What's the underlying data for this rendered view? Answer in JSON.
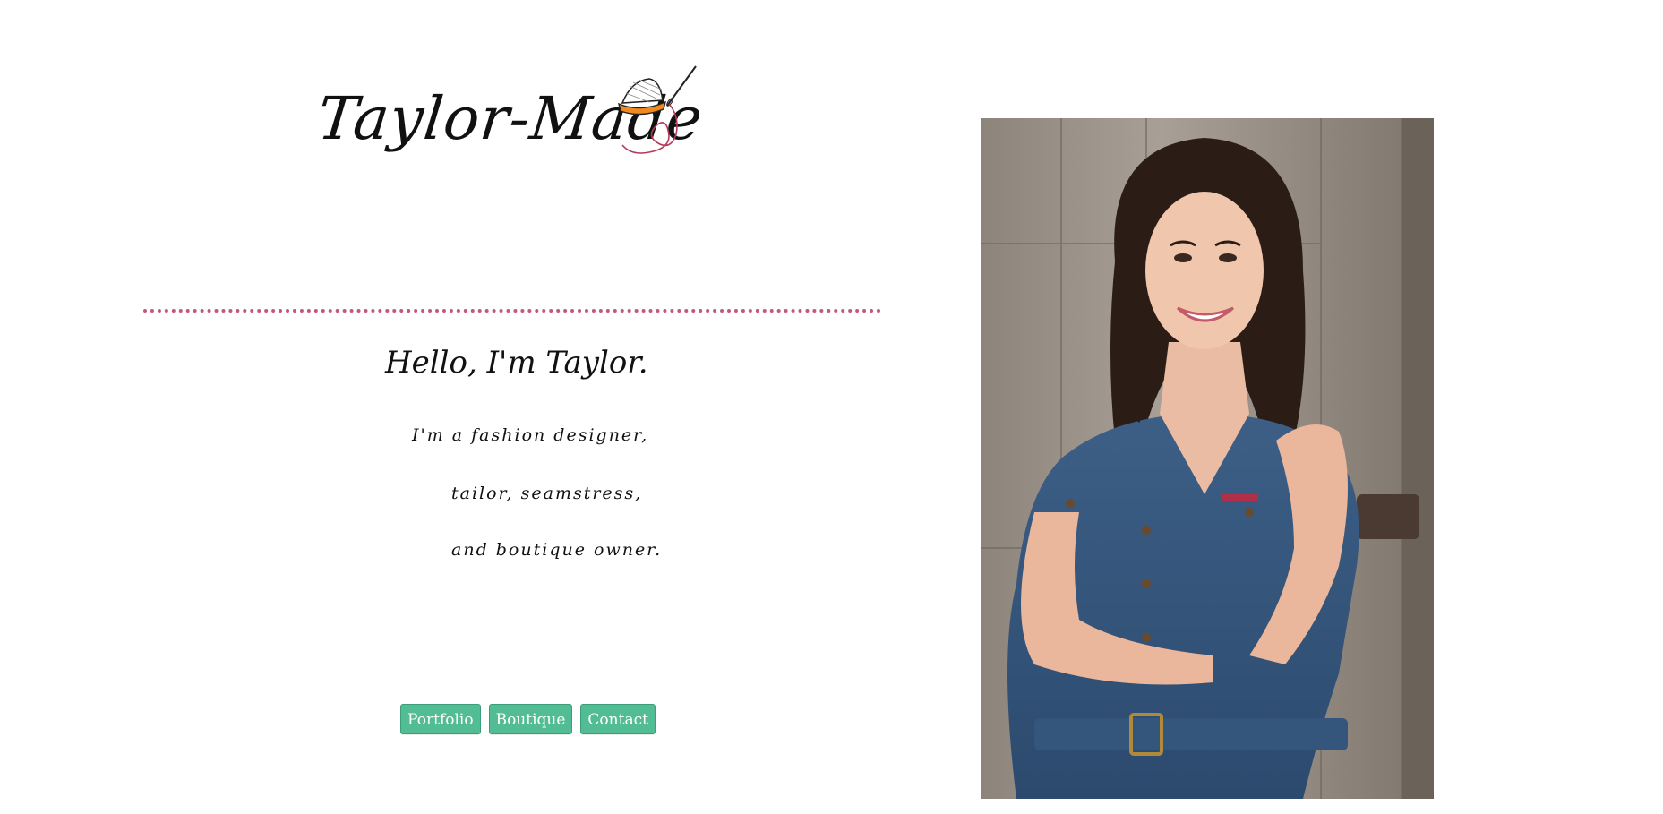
{
  "logo": {
    "text": "Taylor-Made",
    "icon": "thimble-needle-icon"
  },
  "intro": {
    "greeting": "Hello, I'm Taylor.",
    "lines": [
      "I'm a fashion designer,",
      "tailor, seamstress,",
      "and boutique owner."
    ]
  },
  "nav": {
    "buttons": [
      {
        "label": "Portfolio"
      },
      {
        "label": "Boutique"
      },
      {
        "label": "Contact"
      }
    ]
  },
  "colors": {
    "divider": "#c2597a",
    "button_bg": "#52bd95",
    "button_text": "#ffffff"
  },
  "portrait": {
    "subject": "woman in denim dress leaning on wooden door"
  }
}
